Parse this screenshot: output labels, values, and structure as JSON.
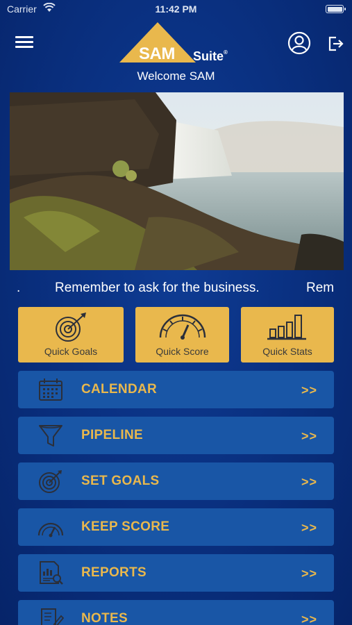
{
  "status_bar": {
    "carrier": "Carrier",
    "time": "11:42 PM"
  },
  "header": {
    "logo_primary": "SAM",
    "logo_secondary": "Suite",
    "logo_reg": "®",
    "welcome": "Welcome SAM",
    "menu_icon": "hamburger-icon",
    "user_icon": "user-circle-icon",
    "logout_icon": "logout-icon"
  },
  "hero": {
    "image": "waterfall-landscape-photo"
  },
  "ticker": {
    "lead": ".",
    "message": "Remember to ask for the business.",
    "repeat": "Rem"
  },
  "quick_actions": [
    {
      "label": "Quick Goals",
      "icon": "target-icon"
    },
    {
      "label": "Quick Score",
      "icon": "gauge-icon"
    },
    {
      "label": "Quick Stats",
      "icon": "bar-chart-icon"
    }
  ],
  "nav_items": [
    {
      "label": "CALENDAR",
      "arrow": ">>",
      "icon": "calendar-icon"
    },
    {
      "label": "PIPELINE",
      "arrow": ">>",
      "icon": "funnel-icon"
    },
    {
      "label": "SET GOALS",
      "arrow": ">>",
      "icon": "target-icon"
    },
    {
      "label": "KEEP SCORE",
      "arrow": ">>",
      "icon": "gauge-icon"
    },
    {
      "label": "REPORTS",
      "arrow": ">>",
      "icon": "report-icon"
    },
    {
      "label": "NOTES",
      "arrow": ">>",
      "icon": "notes-icon"
    }
  ],
  "colors": {
    "background": "#0a3182",
    "accent": "#e9b84d",
    "row_background": "#1956a6",
    "icon_line": "#2b2f3a"
  }
}
